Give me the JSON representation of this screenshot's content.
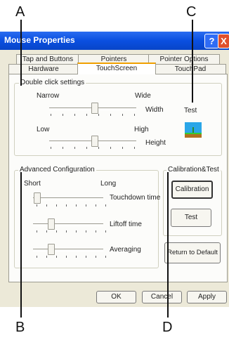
{
  "callouts": {
    "a": "A",
    "b": "B",
    "c": "C",
    "d": "D"
  },
  "window": {
    "title": "Mouse Properties",
    "help_glyph": "?",
    "close_glyph": "X"
  },
  "tabs": {
    "row1": [
      "Tap and Buttons",
      "Pointers",
      "Pointer Options"
    ],
    "row2": [
      "Hardware",
      "TouchScreen",
      "TouchPad"
    ],
    "active": "TouchScreen"
  },
  "double_click": {
    "title": "Double click settings",
    "narrow": "Narrow",
    "wide": "Wide",
    "width": "Width",
    "test": "Test",
    "low": "Low",
    "high": "High",
    "height": "Height",
    "width_level": 0.5,
    "height_level": 0.5,
    "test_icon": "double-click-test-scene"
  },
  "advanced": {
    "title": "Advanced Configuration",
    "short": "Short",
    "long": "Long",
    "touchdown_time": "Touchdown time",
    "liftoff_time": "Liftoff time",
    "averaging": "Averaging",
    "touchdown_level": 0.0,
    "liftoff_level": 0.2,
    "averaging_level": 0.2
  },
  "calibration": {
    "title": "Calibration&Test",
    "calibration_button": "Calibration",
    "test_button": "Test"
  },
  "return_default": "Return to Default",
  "footer": {
    "ok": "OK",
    "cancel": "Cancel",
    "apply": "Apply"
  }
}
